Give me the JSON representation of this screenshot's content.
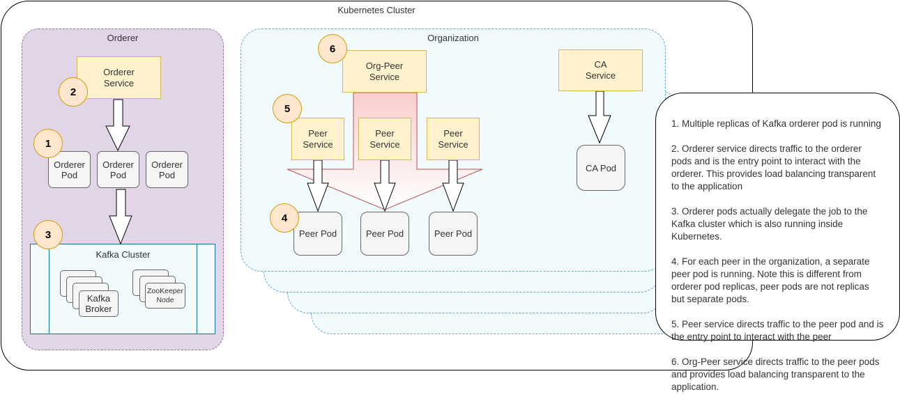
{
  "diagram": {
    "cluster_title": "Kubernetes Cluster",
    "orderer": {
      "title": "Orderer",
      "service_label": "Orderer\nService",
      "pods": [
        "Orderer\nPod",
        "Orderer\nPod",
        "Orderer\nPod"
      ],
      "kafka": {
        "title": "Kafka Cluster",
        "broker_label": "Kafka\nBroker",
        "zookeeper_label": "ZooKeeper\nNode"
      }
    },
    "organization": {
      "title": "Organization",
      "org_peer_service_label": "Org-Peer\nService",
      "peer_services": [
        "Peer\nService",
        "Peer\nService",
        "Peer\nService"
      ],
      "peer_pods": [
        "Peer Pod",
        "Peer Pod",
        "Peer Pod"
      ],
      "ca_service_label": "CA\nService",
      "ca_pod_label": "CA Pod"
    },
    "badges": [
      "1",
      "2",
      "3",
      "4",
      "5",
      "6"
    ],
    "notes": [
      "1. Multiple replicas of Kafka orderer pod is running",
      "2. Orderer service directs traffic to the orderer pods and is the entry point to interact with the orderer. This provides load balancing transparent to the application",
      "3. Orderer pods actually delegate the job to the Kafka cluster which is also running inside Kubernetes.",
      "4. For each peer in the organization, a separate peer pod is running. Note this is different from orderer pod replicas, peer pods are not replicas but separate pods.",
      "5. Peer service directs traffic to the peer pod and is the entry point to interact with the peer",
      "6. Org-Peer service directs traffic to the peer pods and provides load balancing transparent to the application."
    ],
    "colors": {
      "service_fill": "#fff2cc",
      "service_stroke": "#d6b656",
      "pod_fill": "#f5f5f5",
      "badge_fill": "#ffe6cc",
      "badge_stroke": "#d79b00",
      "orderer_fill": "#e1d5e7",
      "organization_fill": "#f1fafd",
      "funnel_stroke": "#b85450"
    }
  }
}
